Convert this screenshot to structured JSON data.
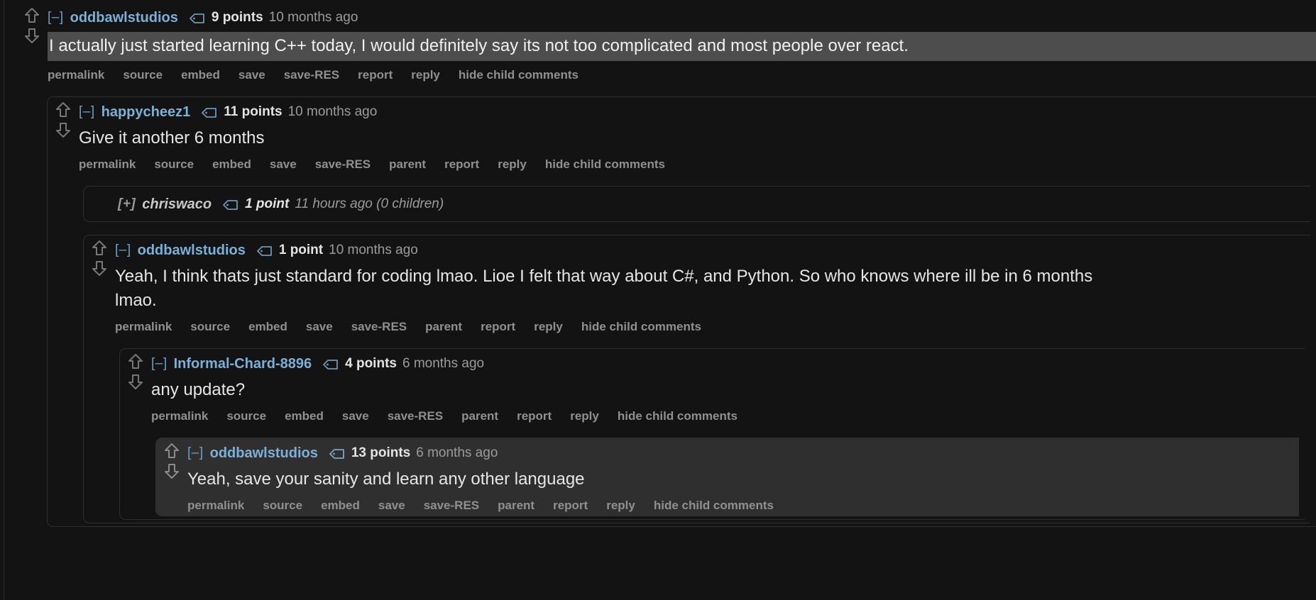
{
  "theme": {
    "page_background": "#131313",
    "username_color": "#7cb0d7",
    "toggle_color": "#6a9fc6",
    "action_link_color": "#909090",
    "timestamp_color": "#9b9b9b",
    "body_text_color": "#e6e6e6",
    "highlight_band": "#4d4d4d",
    "highlighted_comment_background": "#2f2f2f",
    "border_color": "#2e2e2e"
  },
  "icons": {
    "upvote": "upvote-arrow-icon",
    "downvote": "downvote-arrow-icon",
    "points_tag": "tag-icon"
  },
  "actions": {
    "permalink": "permalink",
    "source": "source",
    "embed": "embed",
    "save": "save",
    "save_res": "save-RES",
    "parent": "parent",
    "report": "report",
    "reply": "reply",
    "hide_child_comments": "hide child comments"
  },
  "comments": [
    {
      "id": "c0",
      "depth": 0,
      "collapsed": false,
      "highlighted": false,
      "toggle": "[–]",
      "username": "oddbawlstudios",
      "points": "9 points",
      "timestamp": "10 months ago",
      "body": "I actually just started learning C++ today, I would definitely say its not too complicated and most people over react.",
      "body_band_highlight": true,
      "actions": [
        "permalink",
        "source",
        "embed",
        "save",
        "save-RES",
        "report",
        "reply",
        "hide child comments"
      ]
    },
    {
      "id": "c1",
      "depth": 1,
      "collapsed": false,
      "highlighted": false,
      "toggle": "[–]",
      "username": "happycheez1",
      "points": "11 points",
      "timestamp": "10 months ago",
      "body": "Give it another 6 months",
      "body_band_highlight": false,
      "actions": [
        "permalink",
        "source",
        "embed",
        "save",
        "save-RES",
        "parent",
        "report",
        "reply",
        "hide child comments"
      ]
    },
    {
      "id": "c2",
      "depth": 2,
      "collapsed": true,
      "highlighted": false,
      "toggle": "[+]",
      "username": "chriswaco",
      "points": "1 point",
      "timestamp": "11 hours ago (0 children)",
      "body": "",
      "body_band_highlight": false,
      "actions": []
    },
    {
      "id": "c3",
      "depth": 2,
      "collapsed": false,
      "highlighted": false,
      "toggle": "[–]",
      "username": "oddbawlstudios",
      "points": "1 point",
      "timestamp": "10 months ago",
      "body": "Yeah, I think thats just standard for coding lmao. Lioe I felt that way about C#, and Python. So who knows where ill be in 6 months lmao.",
      "body_band_highlight": false,
      "actions": [
        "permalink",
        "source",
        "embed",
        "save",
        "save-RES",
        "parent",
        "report",
        "reply",
        "hide child comments"
      ]
    },
    {
      "id": "c4",
      "depth": 3,
      "collapsed": false,
      "highlighted": false,
      "toggle": "[–]",
      "username": "Informal-Chard-8896",
      "points": "4 points",
      "timestamp": "6 months ago",
      "body": "any update?",
      "body_band_highlight": false,
      "actions": [
        "permalink",
        "source",
        "embed",
        "save",
        "save-RES",
        "parent",
        "report",
        "reply",
        "hide child comments"
      ]
    },
    {
      "id": "c5",
      "depth": 4,
      "collapsed": false,
      "highlighted": true,
      "toggle": "[–]",
      "username": "oddbawlstudios",
      "points": "13 points",
      "timestamp": "6 months ago",
      "body": "Yeah, save your sanity and learn any other language",
      "body_band_highlight": false,
      "actions": [
        "permalink",
        "source",
        "embed",
        "save",
        "save-RES",
        "parent",
        "report",
        "reply",
        "hide child comments"
      ]
    }
  ]
}
